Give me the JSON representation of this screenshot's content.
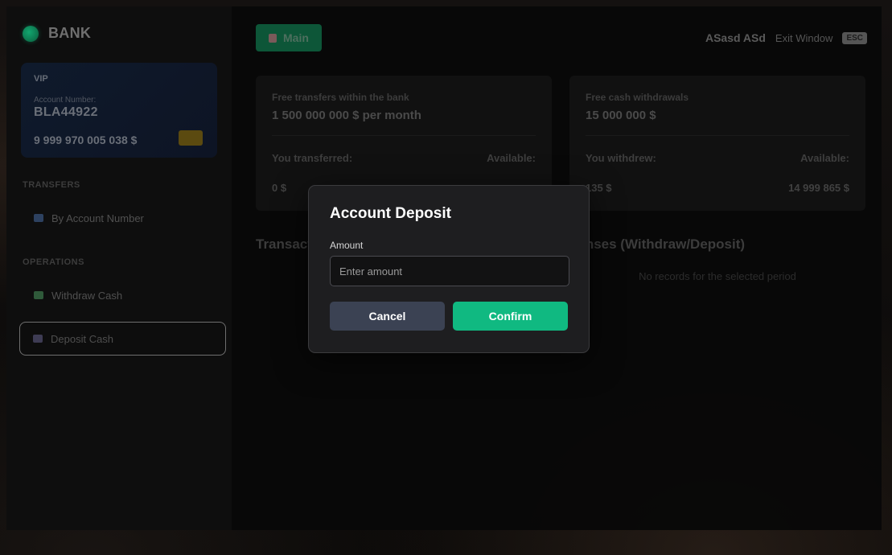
{
  "brand": {
    "name": "BANK",
    "color": "#10b981"
  },
  "account": {
    "tier": "VIP",
    "number_label": "Account Number:",
    "number": "BLA44922",
    "balance": "9 999 970 005 038 $"
  },
  "sidebar": {
    "transfers_title": "TRANSFERS",
    "transfers": [
      {
        "label": "By Account Number",
        "icon": "card-icon"
      }
    ],
    "operations_title": "OPERATIONS",
    "operations": [
      {
        "label": "Withdraw Cash",
        "icon": "cash-icon"
      },
      {
        "label": "Deposit Cash",
        "icon": "safe-icon",
        "active": true
      }
    ]
  },
  "topbar": {
    "main_label": "Main",
    "user_name": "ASasd ASd",
    "exit_label": "Exit Window",
    "exit_key": "ESC"
  },
  "transfers_card": {
    "label": "Free transfers within the bank",
    "limit": "1 500 000 000 $ per month",
    "used_label": "You transferred:",
    "available_label": "Available:",
    "used_value": "0 $"
  },
  "withdrawals_card": {
    "label": "Free cash withdrawals",
    "limit": "15 000 000 $",
    "used_label": "You withdrew:",
    "available_label": "Available:",
    "used_value": "135 $",
    "available_value": "14 999 865 $"
  },
  "lists": {
    "left_title": "Transact",
    "right_title": "penses (Withdraw/Deposit)",
    "right_empty": "No records for the selected period"
  },
  "modal": {
    "title": "Account Deposit",
    "amount_label": "Amount",
    "amount_placeholder": "Enter amount",
    "cancel_label": "Cancel",
    "confirm_label": "Confirm",
    "confirm_color": "#10b981",
    "cancel_color": "#3b4253"
  }
}
